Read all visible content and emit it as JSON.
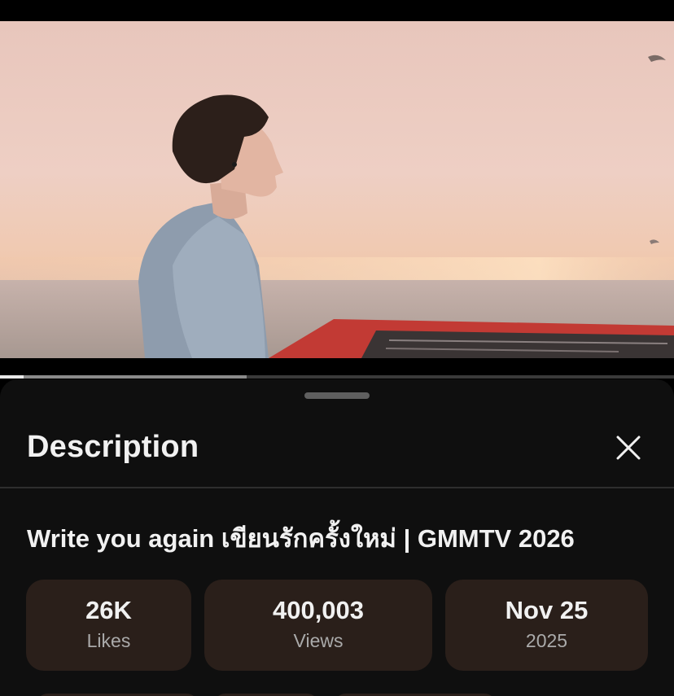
{
  "player": {
    "progress_fraction": 0.035,
    "buffer_fraction": 0.366
  },
  "sheet": {
    "title": "Description",
    "close_icon": "close-icon"
  },
  "video": {
    "title": "Write you again เขียนรักครั้งใหม่ | GMMTV 2026"
  },
  "stats": {
    "likes": {
      "value": "26K",
      "label": "Likes"
    },
    "views": {
      "value": "400,003",
      "label": "Views"
    },
    "date": {
      "value": "Nov 25",
      "label": "2025"
    }
  },
  "colors": {
    "sheet_bg": "#0f0f0f",
    "stat_bg": "#2a1f1a",
    "text_primary": "#f1f1f1",
    "text_secondary": "#aaaaaa"
  }
}
